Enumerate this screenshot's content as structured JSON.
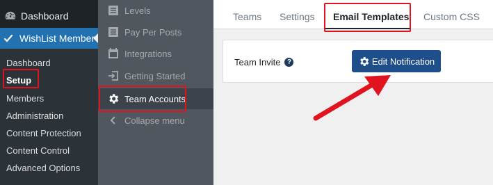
{
  "wp_sidebar": {
    "dashboard": {
      "label": "Dashboard",
      "icon": "dashboard-gauge-icon"
    },
    "current": {
      "label": "WishList Member",
      "icon": "wishlist-check-icon"
    },
    "sub_items": [
      {
        "label": "Dashboard"
      },
      {
        "label": "Setup",
        "active": true
      },
      {
        "label": "Members"
      },
      {
        "label": "Administration"
      },
      {
        "label": "Content Protection"
      },
      {
        "label": "Content Control"
      },
      {
        "label": "Advanced Options"
      }
    ]
  },
  "mid_sidebar": {
    "items": [
      {
        "label": "Levels",
        "icon": "document-icon"
      },
      {
        "label": "Pay Per Posts",
        "icon": "document-icon"
      },
      {
        "label": "Integrations",
        "icon": "calendar-icon"
      },
      {
        "label": "Getting Started",
        "icon": "enter-icon"
      },
      {
        "label": "Team Accounts",
        "icon": "gear-icon",
        "active": true
      },
      {
        "label": "Collapse menu",
        "icon": "chevron-left-icon"
      }
    ]
  },
  "tabs": [
    {
      "label": "Teams"
    },
    {
      "label": "Settings"
    },
    {
      "label": "Email Templates",
      "active": true
    },
    {
      "label": "Custom CSS"
    }
  ],
  "panel": {
    "label": "Team Invite",
    "help_icon": "question-circle-icon",
    "button": {
      "label": "Edit Notification",
      "icon": "gear-icon"
    }
  },
  "colors": {
    "highlight": "#e0141e",
    "accent": "#2271b1",
    "button": "#1e4f8a"
  }
}
